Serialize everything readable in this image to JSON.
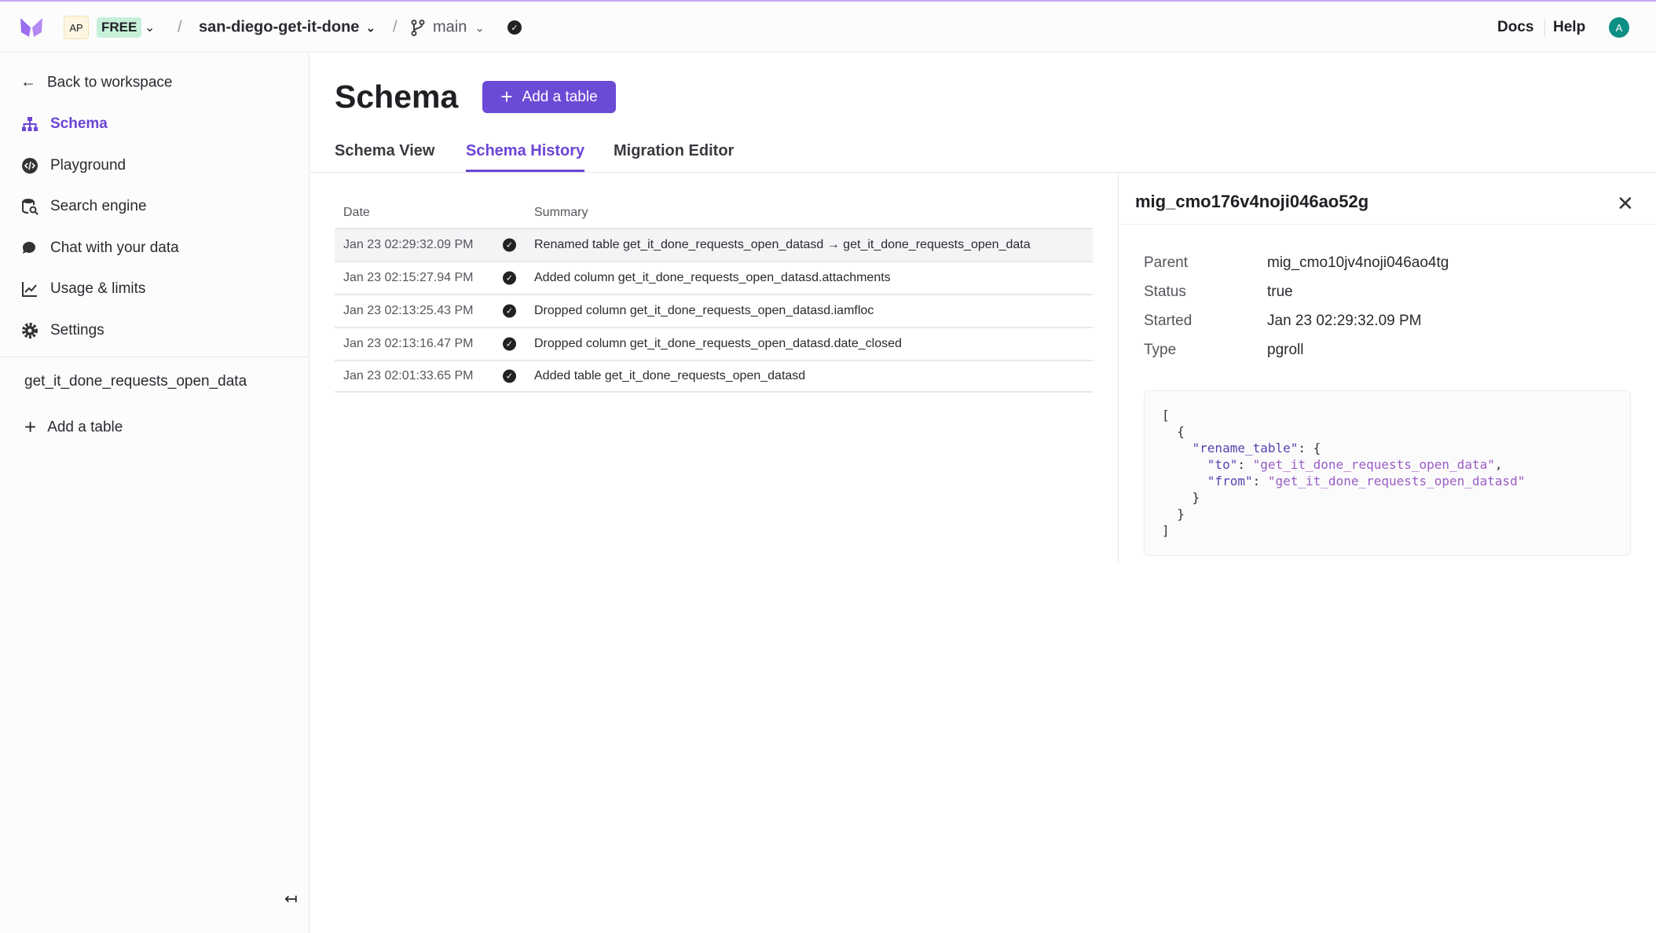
{
  "topbar": {
    "workspace_initials": "AP",
    "plan": "FREE",
    "database": "san-diego-get-it-done",
    "branch": "main",
    "docs": "Docs",
    "help": "Help",
    "avatar": "A",
    "accent": "#6b4bd6"
  },
  "sidebar": {
    "back": "Back to workspace",
    "items": [
      {
        "label": "Schema",
        "icon": "schema-icon",
        "active": true
      },
      {
        "label": "Playground",
        "icon": "playground-icon"
      },
      {
        "label": "Search engine",
        "icon": "search-engine-icon"
      },
      {
        "label": "Chat with your data",
        "icon": "chat-icon"
      },
      {
        "label": "Usage & limits",
        "icon": "chart-icon"
      },
      {
        "label": "Settings",
        "icon": "gear-icon"
      }
    ],
    "tables": [
      "get_it_done_requests_open_data"
    ],
    "add_table": "Add a table"
  },
  "main": {
    "title": "Schema",
    "add_table_button": "Add a table",
    "tabs": [
      {
        "label": "Schema View"
      },
      {
        "label": "Schema History",
        "active": true
      },
      {
        "label": "Migration Editor"
      }
    ],
    "history": {
      "columns": [
        "Date",
        "Summary"
      ],
      "rows": [
        {
          "date": "Jan 23 02:29:32.09 PM",
          "summary": "Renamed table get_it_done_requests_open_datasd → get_it_done_requests_open_data"
        },
        {
          "date": "Jan 23 02:15:27.94 PM",
          "summary": "Added column get_it_done_requests_open_datasd.attachments"
        },
        {
          "date": "Jan 23 02:13:25.43 PM",
          "summary": "Dropped column get_it_done_requests_open_datasd.iamfloc"
        },
        {
          "date": "Jan 23 02:13:16.47 PM",
          "summary": "Dropped column get_it_done_requests_open_datasd.date_closed"
        },
        {
          "date": "Jan 23 02:01:33.65 PM",
          "summary": "Added table get_it_done_requests_open_datasd"
        }
      ]
    }
  },
  "detail": {
    "title": "mig_cmo176v4noji046ao52g",
    "props": [
      {
        "label": "Parent",
        "value": "mig_cmo10jv4noji046ao4tg"
      },
      {
        "label": "Status",
        "value": "true"
      },
      {
        "label": "Started",
        "value": "Jan 23 02:29:32.09 PM"
      },
      {
        "label": "Type",
        "value": "pgroll"
      }
    ],
    "code": {
      "key_op": "\"rename_table\"",
      "key_to": "\"to\"",
      "val_to": "\"get_it_done_requests_open_data\"",
      "key_from": "\"from\"",
      "val_from": "\"get_it_done_requests_open_datasd\""
    }
  }
}
